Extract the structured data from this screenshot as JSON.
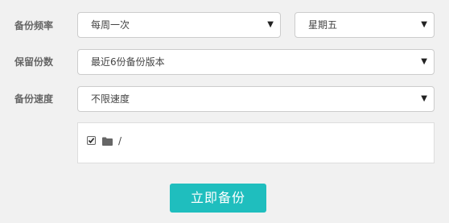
{
  "form": {
    "frequency": {
      "label": "备份频率",
      "period_value": "每周一次",
      "day_value": "星期五"
    },
    "retention": {
      "label": "保留份数",
      "value": "最近6份备份版本"
    },
    "speed": {
      "label": "备份速度",
      "value": "不限速度"
    },
    "directory": {
      "checked": true,
      "path": "/"
    },
    "submit_label": "立即备份"
  },
  "icons": {
    "dropdown": "chevron-down-icon",
    "folder": "folder-icon",
    "checkbox": "checkmark-icon"
  },
  "colors": {
    "background": "#f1f1f1",
    "accent": "#1fbebe"
  }
}
